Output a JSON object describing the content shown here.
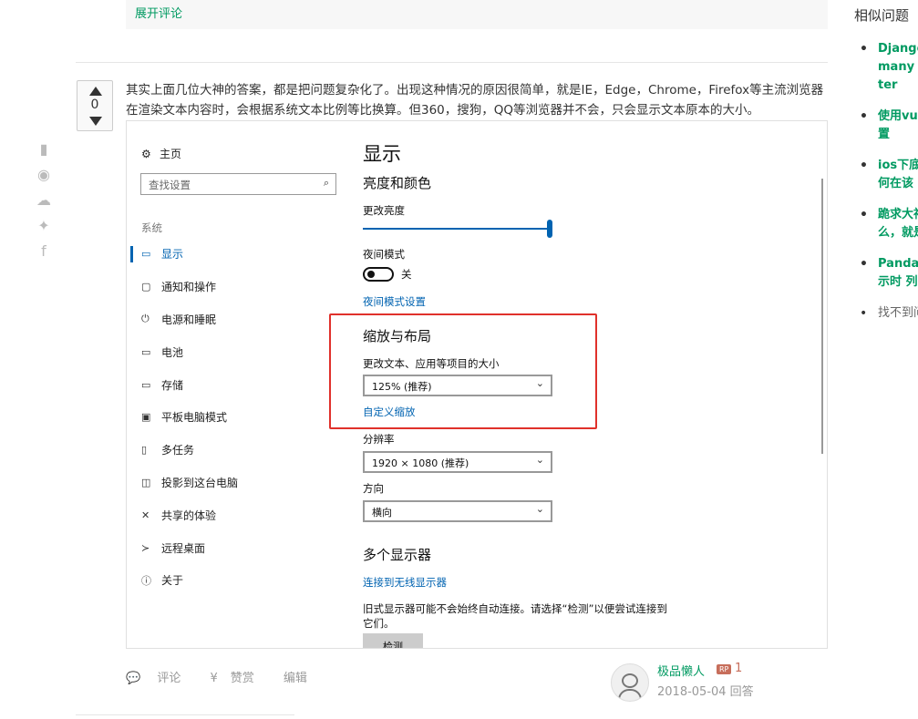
{
  "comments": {
    "expand_label": "展开评论"
  },
  "vote": {
    "count": "0"
  },
  "answer": {
    "text": "其实上面几位大神的答案，都是把问题复杂化了。出现这种情况的原因很简单，就是IE，Edge，Chrome，Firefox等主流浏览器在渲染文本内容时，会根据系统文本比例等比换算。但360，搜狗，QQ等浏览器并不会，只会显示文本原本的大小。"
  },
  "settings": {
    "home": "主页",
    "search_placeholder": "查找设置",
    "section": "系统",
    "nav": [
      {
        "icon": "monitor-icon",
        "glyph": "▭",
        "label": "显示",
        "active": true
      },
      {
        "icon": "notification-icon",
        "glyph": "▢",
        "label": "通知和操作"
      },
      {
        "icon": "power-icon",
        "glyph": "⏻",
        "label": "电源和睡眠"
      },
      {
        "icon": "battery-icon",
        "glyph": "▭",
        "label": "电池"
      },
      {
        "icon": "storage-icon",
        "glyph": "▭",
        "label": "存储"
      },
      {
        "icon": "tablet-icon",
        "glyph": "▣",
        "label": "平板电脑模式"
      },
      {
        "icon": "multitask-icon",
        "glyph": "▯",
        "label": "多任务"
      },
      {
        "icon": "project-icon",
        "glyph": "◫",
        "label": "投影到这台电脑"
      },
      {
        "icon": "share-icon",
        "glyph": "✕",
        "label": "共享的体验"
      },
      {
        "icon": "remote-desktop-icon",
        "glyph": "≻",
        "label": "远程桌面"
      },
      {
        "icon": "info-icon",
        "glyph": "ⓘ",
        "label": "关于"
      }
    ],
    "main": {
      "title": "显示",
      "brightness_heading": "亮度和颜色",
      "brightness_label": "更改亮度",
      "brightness_level": 1.0,
      "night_mode_label": "夜间模式",
      "night_mode_state": "关",
      "night_mode_link": "夜间模式设置",
      "scale_heading": "缩放与布局",
      "scale_label": "更改文本、应用等项目的大小",
      "scale_value": "125% (推荐)",
      "custom_scale_link": "自定义缩放",
      "resolution_label": "分辨率",
      "resolution_value": "1920 × 1080 (推荐)",
      "orientation_label": "方向",
      "orientation_value": "横向",
      "multi_heading": "多个显示器",
      "wireless_link": "连接到无线显示器",
      "legacy_text": "旧式显示器可能不会始终自动连接。请选择“检测”以便尝试连接到它们。",
      "detect_button": "检测"
    }
  },
  "actions": {
    "comment": "评论",
    "reward": "赞赏",
    "edit": "编辑"
  },
  "author": {
    "name": "极品懒人",
    "rp_badge": "RP",
    "reputation": "1",
    "date": "2018-05-04 回答"
  },
  "sidebar": {
    "title": "相似问题",
    "items": [
      {
        "lines": [
          "Django",
          "many t",
          "ter"
        ]
      },
      {
        "lines": [
          "使用vu",
          "置"
        ]
      },
      {
        "lines": [
          "ios下底",
          "何在该"
        ]
      },
      {
        "lines": [
          "跪求大神",
          "么，就是"
        ]
      },
      {
        "lines": [
          "Pandas",
          "示时 列"
        ]
      },
      {
        "lines": [
          "找不到问"
        ],
        "muted": true
      }
    ]
  },
  "colors": {
    "accent": "#009a61",
    "win_blue": "#0063b1",
    "highlight_red": "#e0312b"
  }
}
